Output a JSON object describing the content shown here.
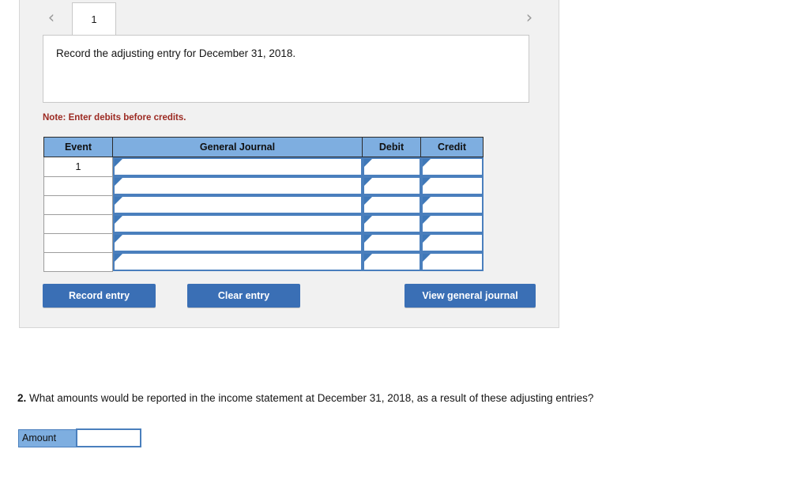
{
  "panel": {
    "nav": {
      "prev_icon": "chevron-left-icon",
      "prev_glyph": "‹",
      "next_icon": "chevron-right-icon",
      "next_glyph": "›"
    },
    "tabs": [
      {
        "label": "1",
        "active": true
      }
    ],
    "prompt": "Record the adjusting entry for December 31, 2018.",
    "note": "Note: Enter debits before credits.",
    "table": {
      "headers": [
        "Event",
        "General Journal",
        "Debit",
        "Credit"
      ],
      "rows": [
        {
          "event": "1",
          "journal": "",
          "debit": "",
          "credit": ""
        },
        {
          "event": "",
          "journal": "",
          "debit": "",
          "credit": ""
        },
        {
          "event": "",
          "journal": "",
          "debit": "",
          "credit": ""
        },
        {
          "event": "",
          "journal": "",
          "debit": "",
          "credit": ""
        },
        {
          "event": "",
          "journal": "",
          "debit": "",
          "credit": ""
        },
        {
          "event": "",
          "journal": "",
          "debit": "",
          "credit": ""
        }
      ]
    },
    "buttons": {
      "record": "Record entry",
      "clear": "Clear entry",
      "view": "View general journal"
    }
  },
  "question2": {
    "number": "2.",
    "text": " What amounts would be reported in the income statement at December 31, 2018, as a result of these adjusting entries?",
    "amount_label": "Amount",
    "amount_value": ""
  },
  "colors": {
    "header_blue": "#7eaee0",
    "button_blue": "#3a6fb5",
    "cell_border_blue": "#4a7fbd",
    "note_red": "#9c2a22",
    "panel_bg": "#f1f1f1"
  }
}
